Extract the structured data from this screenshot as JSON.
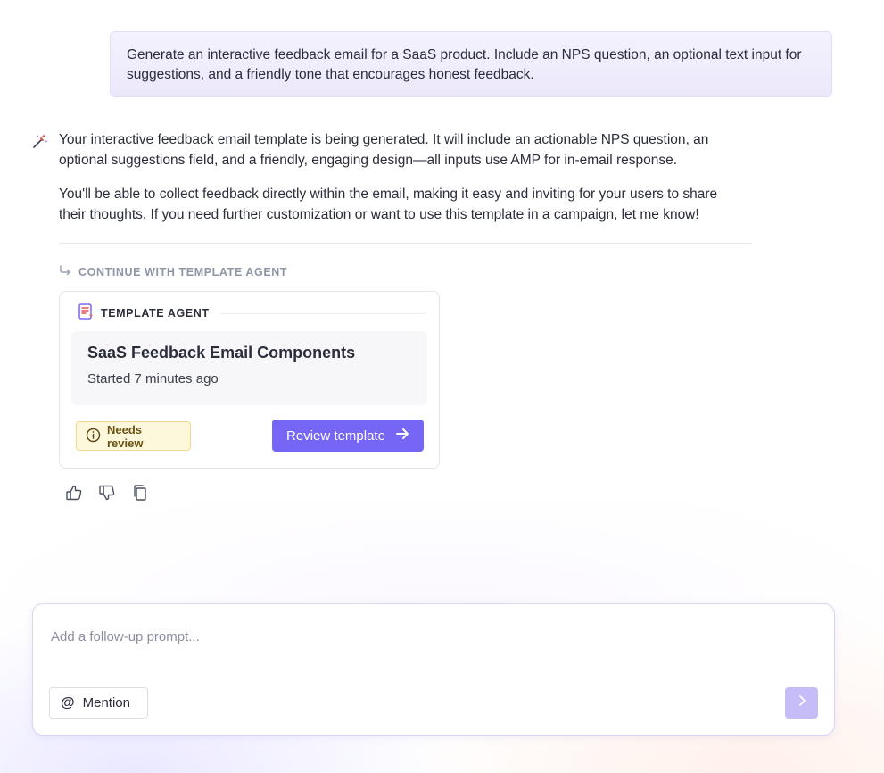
{
  "user_message": "Generate an interactive feedback email for a SaaS product. Include an NPS question, an optional text input for suggestions, and a friendly tone that encourages honest feedback.",
  "assistant": {
    "icon": "magic-wand-icon",
    "paragraphs": [
      "Your interactive feedback email template is being generated. It will include an actionable NPS question, an optional suggestions field, and a friendly, engaging design—all inputs use AMP for in-email response.",
      "You'll be able to collect feedback directly within the email, making it easy and inviting for your users to share their thoughts. If you need further customization or want to use this template in a campaign, let me know!"
    ]
  },
  "continue_label": "CONTINUE WITH TEMPLATE AGENT",
  "agent_card": {
    "header": "TEMPLATE AGENT",
    "title": "SaaS Feedback Email Components",
    "subtitle": "Started 7 minutes ago",
    "status_badge": "Needs review",
    "action_label": "Review template"
  },
  "feedback_icons": [
    "thumbs-up-icon",
    "thumbs-down-icon",
    "copy-icon"
  ],
  "composer": {
    "placeholder": "Add a follow-up prompt...",
    "mention_label": "Mention"
  },
  "colors": {
    "accent": "#7566f5",
    "accent_disabled": "#c5bcf8",
    "badge_bg": "#fdf7dc",
    "badge_border": "#f1d88e",
    "user_bubble": "#efebfc"
  }
}
